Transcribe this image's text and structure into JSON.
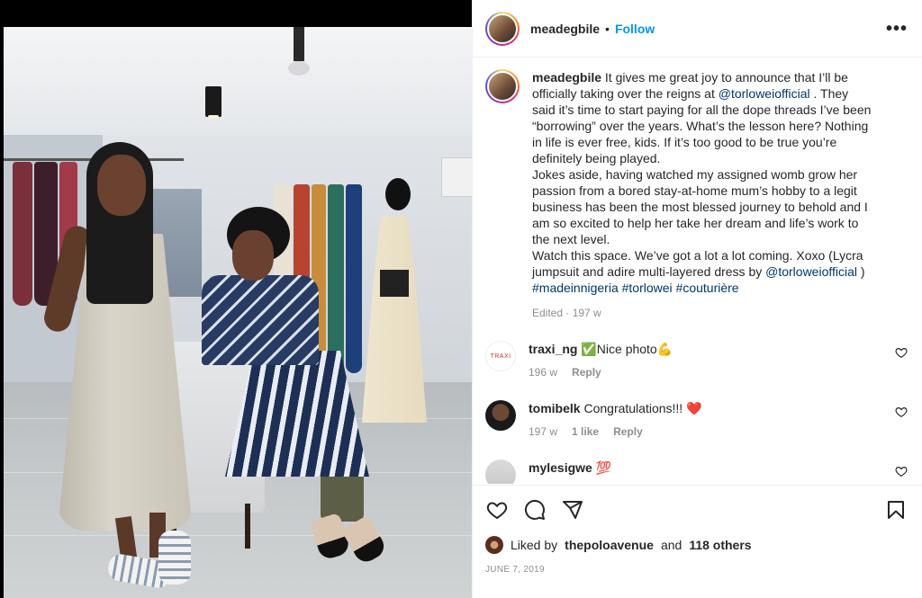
{
  "post": {
    "username": "meadegbile",
    "follow_label": "Follow",
    "dot": "•",
    "more_label": "•••"
  },
  "caption": {
    "username": "meadegbile",
    "p1_a": "It gives me great joy to announce that I’ll be officially taking over the reigns at",
    "p1_mention": "@torloweiofficial",
    "p1_b": ". They said it’s time to start paying for all the dope threads I’ve been “borrowing” over the years. What’s the lesson here? Nothing in life is ever free, kids. If it’s too good to be true you’re definitely being played.",
    "p2": "Jokes aside, having watched my assigned womb grow her passion from a bored stay-at-home mum’s hobby to a legit business has been the most blessed journey to behold and I am so excited to help her take her dream and life’s work to the next level.",
    "p3_a": "Watch this space. We’ve got a lot a lot coming. Xoxo (Lycra jumpsuit and adire multi-layered dress by",
    "p3_mention": "@torloweiofficial",
    "p3_b": ")",
    "tags": [
      "#madeinnigeria",
      "#torlowei",
      "#couturière"
    ],
    "meta": "Edited · 197 w"
  },
  "comments": [
    {
      "username": "traxi_ng",
      "text": "✅Nice photo💪",
      "time": "196 w",
      "likes": "",
      "reply": "Reply",
      "avatar_text": "TRAXI"
    },
    {
      "username": "tomibelk",
      "text": "Congratulations!!! ❤️",
      "time": "197 w",
      "likes": "1 like",
      "reply": "Reply"
    },
    {
      "username": "mylesigwe",
      "text": "💯",
      "time": "",
      "likes": "",
      "reply": ""
    }
  ],
  "likes": {
    "prefix": "Liked by",
    "user": "thepoloavenue",
    "and": "and",
    "others": "118 others"
  },
  "date": "JUNE 7, 2019",
  "icons": [
    "heart-icon",
    "comment-icon",
    "share-icon",
    "bookmark-icon",
    "more-icon"
  ],
  "colors": {
    "link": "#0095f6",
    "mention": "#00376b",
    "muted": "#8e8e8e"
  }
}
